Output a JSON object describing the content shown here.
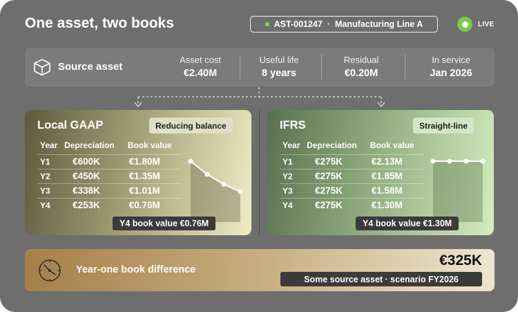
{
  "header": {
    "title": "One asset, two books",
    "asset_id": "AST-001247",
    "separator": "·",
    "asset_line": "Manufacturing Line A",
    "live_label": "LIVE"
  },
  "source": {
    "label": "Source asset",
    "icon": "cube-icon",
    "stats": [
      {
        "label": "Asset cost",
        "value": "€2.40M"
      },
      {
        "label": "Useful life",
        "value": "8 years"
      },
      {
        "label": "Residual",
        "value": "€0.20M"
      },
      {
        "label": "In service",
        "value": "Jan 2026"
      }
    ]
  },
  "gaap": {
    "title": "Local GAAP",
    "method": "Reducing balance",
    "columns": [
      "Year",
      "Depreciation",
      "Book value"
    ],
    "rows": [
      {
        "year": "Y1",
        "dep": "€600K",
        "book": "€1.80M"
      },
      {
        "year": "Y2",
        "dep": "€450K",
        "book": "€1.35M"
      },
      {
        "year": "Y3",
        "dep": "€338K",
        "book": "€1.01M"
      },
      {
        "year": "Y4",
        "dep": "€253K",
        "book": "€0.76M"
      }
    ],
    "book_values_m": [
      1.8,
      1.35,
      1.01,
      0.76
    ],
    "callout": "Y4 book value €0.76M"
  },
  "ifrs": {
    "title": "IFRS",
    "method": "Straight-line",
    "columns": [
      "Year",
      "Depreciation",
      "Book value"
    ],
    "rows": [
      {
        "year": "Y1",
        "dep": "€275K",
        "book": "€2.13M"
      },
      {
        "year": "Y2",
        "dep": "€275K",
        "book": "€1.85M"
      },
      {
        "year": "Y3",
        "dep": "€275K",
        "book": "€1.58M"
      },
      {
        "year": "Y4",
        "dep": "€275K",
        "book": "€1.30M"
      }
    ],
    "depreciation_k": [
      275,
      275,
      275,
      275
    ],
    "callout": "Y4 book value €1.30M"
  },
  "difference": {
    "label": "Year-one book difference",
    "value": "€325K",
    "note": "Some source asset · scenario FY2026",
    "icon": "compass-icon"
  },
  "colors": {
    "live_green": "#7ec84a",
    "frame": "#6e6e6e",
    "callout_bg": "#3b3b3b"
  }
}
